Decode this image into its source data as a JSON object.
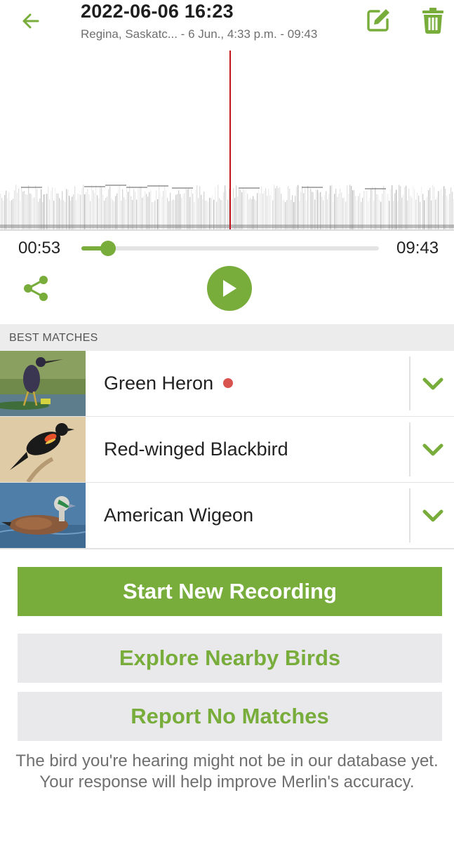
{
  "header": {
    "title": "2022-06-06 16:23",
    "subtitle": "Regina, Saskatc... - 6 Jun., 4:33 p.m. - 09:43"
  },
  "player": {
    "current_time": "00:53",
    "total_time": "09:43",
    "progress": 0.09
  },
  "matches": {
    "header": "BEST MATCHES",
    "items": [
      {
        "name": "Green Heron",
        "indicator": true
      },
      {
        "name": "Red-winged Blackbird",
        "indicator": false
      },
      {
        "name": "American Wigeon",
        "indicator": false
      }
    ]
  },
  "buttons": {
    "start_recording": "Start New Recording",
    "explore_nearby": "Explore Nearby Birds",
    "report_no_matches": "Report No Matches"
  },
  "footnote": "The bird you're hearing might not be in our database yet. Your response will help improve Merlin's accuracy.",
  "colors": {
    "accent": "#78ad3c",
    "playhead": "#c1121f",
    "indicator": "#d9534f"
  },
  "icons": [
    "back-arrow-icon",
    "edit-icon",
    "trash-icon",
    "share-icon",
    "play-icon",
    "chevron-down-icon"
  ]
}
